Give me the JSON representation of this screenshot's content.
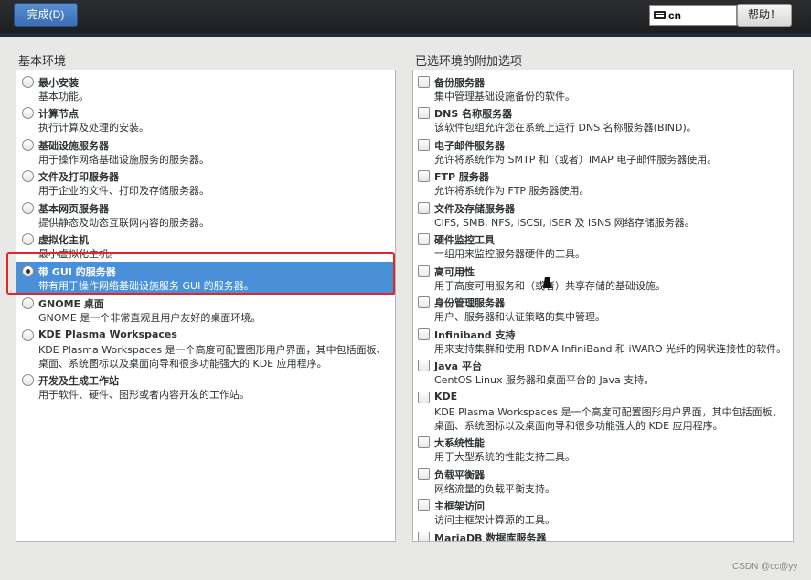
{
  "toolbar": {
    "done_label": "完成(D)",
    "keyboard_layout": "cn",
    "help_label": "帮助！"
  },
  "left": {
    "heading": "基本环境",
    "items": [
      {
        "title": "最小安装",
        "desc": "基本功能。",
        "selected": false
      },
      {
        "title": "计算节点",
        "desc": "执行计算及处理的安装。",
        "selected": false
      },
      {
        "title": "基础设施服务器",
        "desc": "用于操作网络基础设施服务的服务器。",
        "selected": false
      },
      {
        "title": "文件及打印服务器",
        "desc": "用于企业的文件、打印及存储服务器。",
        "selected": false
      },
      {
        "title": "基本网页服务器",
        "desc": "提供静态及动态互联网内容的服务器。",
        "selected": false
      },
      {
        "title": "虚拟化主机",
        "desc": "最小虚拟化主机。",
        "selected": false
      },
      {
        "title": "带 GUI 的服务器",
        "desc": "带有用于操作网络基础设施服务 GUI 的服务器。",
        "selected": true
      },
      {
        "title": "GNOME 桌面",
        "desc": "GNOME 是一个非常直观且用户友好的桌面环境。",
        "selected": false
      },
      {
        "title": "KDE Plasma Workspaces",
        "desc": "KDE Plasma Workspaces 是一个高度可配置图形用户界面，其中包括面板、桌面、系统图标以及桌面向导和很多功能强大的 KDE 应用程序。",
        "selected": false
      },
      {
        "title": "开发及生成工作站",
        "desc": "用于软件、硬件、图形或者内容开发的工作站。",
        "selected": false
      }
    ]
  },
  "right": {
    "heading": "已选环境的附加选项",
    "items": [
      {
        "title": "备份服务器",
        "desc": "集中管理基础设施备份的软件。"
      },
      {
        "title": "DNS 名称服务器",
        "desc": "该软件包组允许您在系统上运行 DNS 名称服务器(BIND)。"
      },
      {
        "title": "电子邮件服务器",
        "desc": "允许将系统作为 SMTP 和（或者）IMAP 电子邮件服务器使用。"
      },
      {
        "title": "FTP 服务器",
        "desc": "允许将系统作为 FTP 服务器使用。"
      },
      {
        "title": "文件及存储服务器",
        "desc": "CIFS, SMB, NFS, iSCSI, iSER 及 iSNS 网络存储服务器。"
      },
      {
        "title": "硬件监控工具",
        "desc": "一组用来监控服务器硬件的工具。"
      },
      {
        "title": "高可用性",
        "desc": "用于高度可用服务和（或者）共享存储的基础设施。"
      },
      {
        "title": "身份管理服务器",
        "desc": "用户、服务器和认证策略的集中管理。"
      },
      {
        "title": "Infiniband 支持",
        "desc": "用来支持集群和使用 RDMA InfiniBand 和 iWARO 光纤的网状连接性的软件。"
      },
      {
        "title": "Java 平台",
        "desc": "CentOS Linux 服务器和桌面平台的 Java 支持。"
      },
      {
        "title": "KDE",
        "desc": "KDE Plasma Workspaces 是一个高度可配置图形用户界面，其中包括面板、桌面、系统图标以及桌面向导和很多功能强大的 KDE 应用程序。"
      },
      {
        "title": "大系统性能",
        "desc": "用于大型系统的性能支持工具。"
      },
      {
        "title": "负载平衡器",
        "desc": "网络流量的负载平衡支持。"
      },
      {
        "title": "主框架访问",
        "desc": "访问主框架计算源的工具。"
      },
      {
        "title": "MariaDB 数据库服务器",
        "desc": ""
      }
    ]
  },
  "watermark": "CSDN @cc@yy"
}
